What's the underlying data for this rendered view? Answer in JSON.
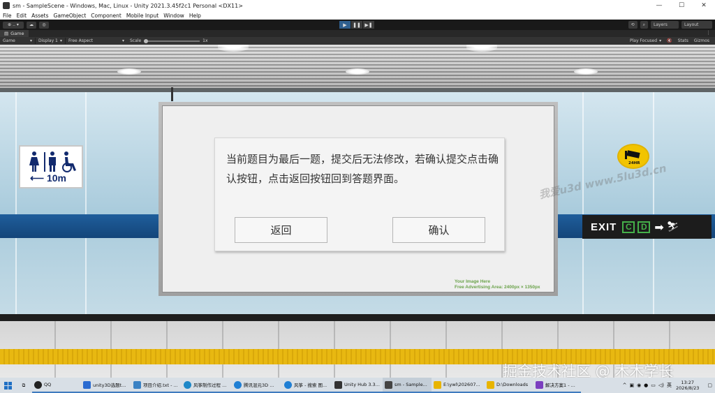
{
  "window": {
    "title": "sm - SampleScene - Windows, Mac, Linux - Unity 2021.3.45f2c1 Personal <DX11>",
    "minimize": "—",
    "maximize": "☐",
    "close": "✕"
  },
  "menu": [
    "File",
    "Edit",
    "Assets",
    "GameObject",
    "Component",
    "Mobile Input",
    "Window",
    "Help"
  ],
  "toolbar": {
    "account": "⊕ .. ▾",
    "layers": "Layers",
    "layout": "Layout"
  },
  "game_tab": {
    "label": "Game",
    "more": "⋮"
  },
  "game_bar": {
    "mode": "Game",
    "display": "Display 1",
    "aspect": "Free Aspect",
    "scale_label": "Scale",
    "scale_value": "1x",
    "play_focused": "Play Focused",
    "stats": "Stats",
    "gizmos": "Gizmos"
  },
  "scene": {
    "toilet_distance": "10m",
    "cctv_label": "24HR",
    "exit_text": "EXIT",
    "exit_letters": [
      "C",
      "D"
    ],
    "ad_line1": "Your Image Here",
    "ad_line2": "Free Advertising Area: 2400px × 1350px",
    "watermark": "我爱u3d  www.5lu3d.cn"
  },
  "dialog": {
    "message": "当前题目为最后一题，提交后无法修改，若确认提交点击确认按钮，点击返回按钮回到答题界面。",
    "back_label": "返回",
    "confirm_label": "确认"
  },
  "overlay_watermark": "掘金技术社区 @ 木木学长",
  "taskbar": {
    "items": [
      {
        "label": "QQ",
        "color": "#222222"
      },
      {
        "label": "unity3D选题t...",
        "color": "#2a6bd1"
      },
      {
        "label": "项目介绍.txt - ...",
        "color": "#3b82c4"
      },
      {
        "label": "风筝制作过程 ...",
        "color": "#1e88c8"
      },
      {
        "label": "腾讯混元3D ...",
        "color": "#1f7fd4"
      },
      {
        "label": "风筝 - 搜索 图...",
        "color": "#1f7fd4"
      },
      {
        "label": "Unity Hub 3.3...",
        "color": "#333333"
      },
      {
        "label": "sm - Sample...",
        "color": "#444444"
      },
      {
        "label": "E:\\ywl\\202607...",
        "color": "#e8b400"
      },
      {
        "label": "D:\\Downloads",
        "color": "#e8b400"
      },
      {
        "label": "解决方案1 - ...",
        "color": "#7b3fbf"
      }
    ],
    "ime": "英",
    "time": "13:27",
    "date": "2026/8/23"
  }
}
